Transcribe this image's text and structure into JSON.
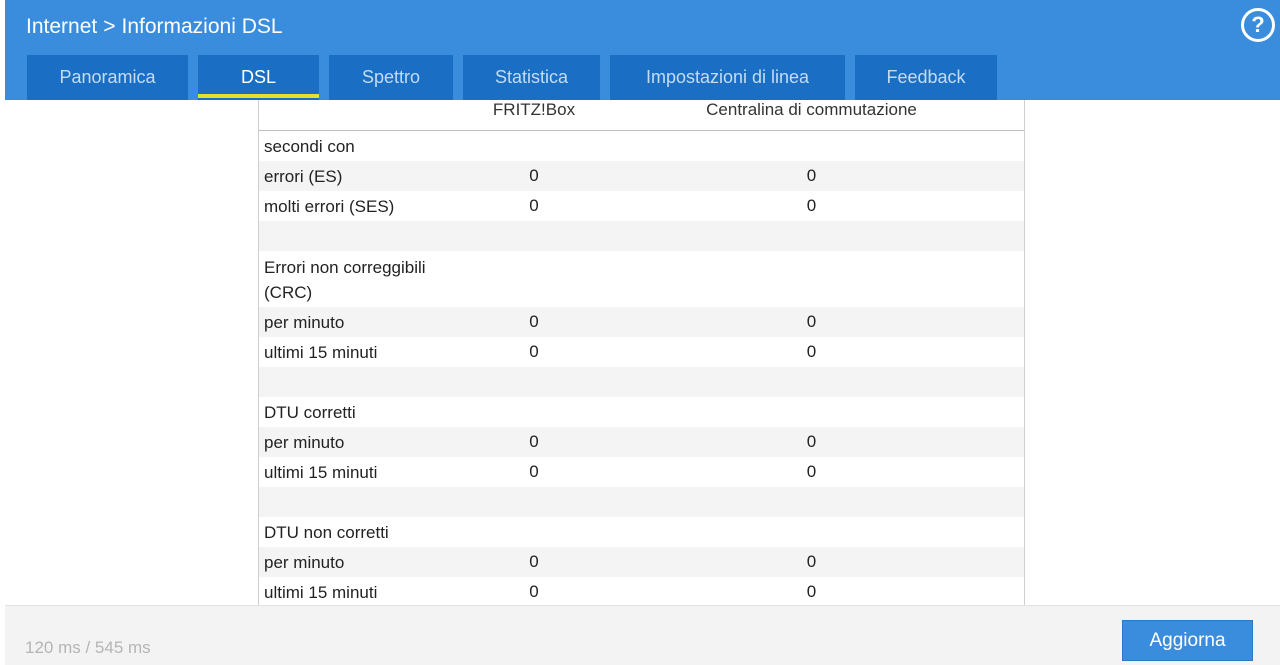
{
  "header": {
    "breadcrumb": [
      "Internet",
      "Informazioni DSL"
    ],
    "separator": ">",
    "help_glyph": "?"
  },
  "tabs": [
    {
      "label": "Panoramica",
      "active": false
    },
    {
      "label": "DSL",
      "active": true
    },
    {
      "label": "Spettro",
      "active": false
    },
    {
      "label": "Statistica",
      "active": false
    },
    {
      "label": "Impostazioni di linea",
      "active": false
    },
    {
      "label": "Feedback",
      "active": false
    }
  ],
  "table": {
    "columns": [
      "",
      "FRITZ!Box",
      "Centralina di commutazione"
    ],
    "rows": [
      {
        "label": "secondi con",
        "fritz": "",
        "central": "",
        "alt": false,
        "tall": false
      },
      {
        "label": "errori (ES)",
        "fritz": "0",
        "central": "0",
        "alt": true,
        "tall": false
      },
      {
        "label": "molti errori (SES)",
        "fritz": "0",
        "central": "0",
        "alt": false,
        "tall": false
      },
      {
        "label": "",
        "fritz": "",
        "central": "",
        "alt": true,
        "tall": false
      },
      {
        "label": "Errori non correggibili (CRC)",
        "fritz": "",
        "central": "",
        "alt": false,
        "tall": true
      },
      {
        "label": "per minuto",
        "fritz": "0",
        "central": "0",
        "alt": true,
        "tall": false
      },
      {
        "label": "ultimi 15 minuti",
        "fritz": "0",
        "central": "0",
        "alt": false,
        "tall": false
      },
      {
        "label": "",
        "fritz": "",
        "central": "",
        "alt": true,
        "tall": false
      },
      {
        "label": "DTU corretti",
        "fritz": "",
        "central": "",
        "alt": false,
        "tall": false
      },
      {
        "label": "per minuto",
        "fritz": "0",
        "central": "0",
        "alt": true,
        "tall": false
      },
      {
        "label": "ultimi 15 minuti",
        "fritz": "0",
        "central": "0",
        "alt": false,
        "tall": false
      },
      {
        "label": "",
        "fritz": "",
        "central": "",
        "alt": true,
        "tall": false
      },
      {
        "label": "DTU non corretti",
        "fritz": "",
        "central": "",
        "alt": false,
        "tall": false
      },
      {
        "label": "per minuto",
        "fritz": "0",
        "central": "0",
        "alt": true,
        "tall": false
      },
      {
        "label": "ultimi 15 minuti",
        "fritz": "0",
        "central": "0",
        "alt": false,
        "tall": false
      }
    ]
  },
  "footer": {
    "timing": "120 ms / 545 ms",
    "refresh_label": "Aggiorna"
  },
  "colors": {
    "header_bg": "#3a8ddc",
    "tab_bg": "#1a6fc4",
    "active_underline": "#e6e02a"
  }
}
